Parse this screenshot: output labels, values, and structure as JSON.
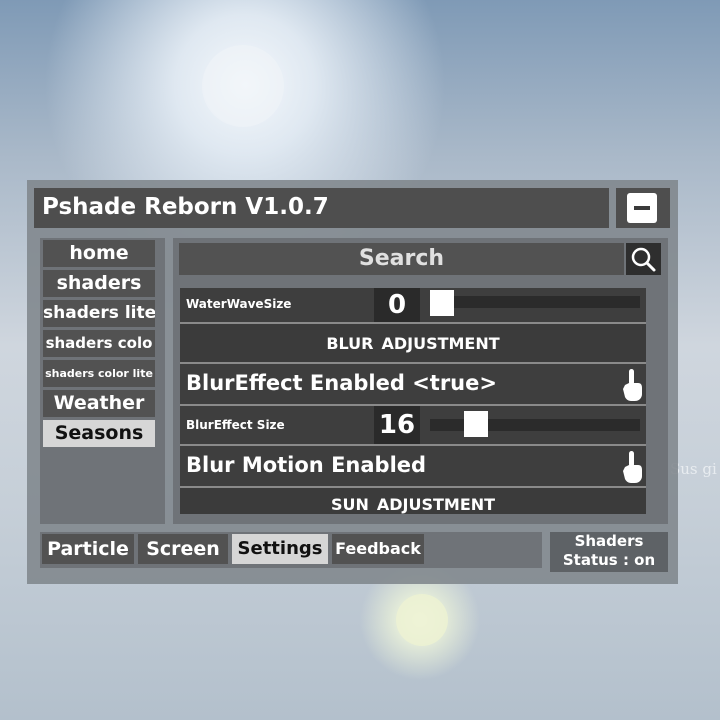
{
  "window": {
    "title": "Pshade Reborn V1.0.7"
  },
  "sidebar": {
    "items": [
      {
        "label": "home"
      },
      {
        "label": "shaders"
      },
      {
        "label": "shaders lite"
      },
      {
        "label": "shaders colo"
      },
      {
        "label": "shaders color lite"
      },
      {
        "label": "Weather"
      },
      {
        "label": "Seasons",
        "active": true
      }
    ]
  },
  "search": {
    "placeholder": "Search"
  },
  "settings": {
    "water_wave_size": {
      "label": "WaterWaveSize",
      "value": "0",
      "slider_fraction": 0.0
    },
    "blur_header": "BLUR ADJUSTMENT",
    "blur_effect_enabled": {
      "label": "BlurEffect Enabled <true>"
    },
    "blur_effect_size": {
      "label": "BlurEffect Size",
      "value": "16",
      "slider_fraction": 0.16
    },
    "blur_motion_enabled": {
      "label": "Blur Motion Enabled"
    },
    "sun_header": "SUN ADJUSTMENT"
  },
  "tabs": [
    {
      "label": "Particle"
    },
    {
      "label": "Screen"
    },
    {
      "label": "Settings",
      "active": true
    },
    {
      "label": "Feedback"
    }
  ],
  "status": {
    "line1": "Shaders",
    "line2": "Status : on"
  },
  "background_text": "Sus gi",
  "colors": {
    "panel": "#6f7378",
    "button": "#525252",
    "active": "#d6d6d6",
    "row": "#3e3e3e"
  },
  "icons": [
    "minimize-icon",
    "search-icon",
    "pointer-hand-icon"
  ]
}
